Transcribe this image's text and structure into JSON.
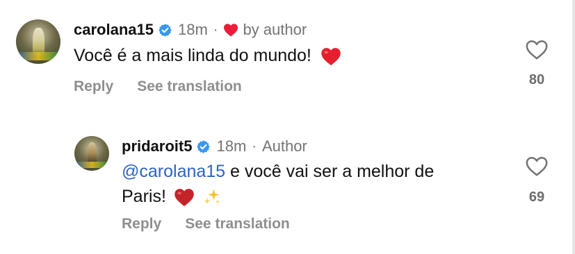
{
  "comments": [
    {
      "username": "carolana15",
      "time": "18m",
      "author_like": "by author",
      "text": "Você é a mais linda do mundo!",
      "reply_label": "Reply",
      "translate_label": "See translation",
      "likes": "80"
    },
    {
      "username": "pridaroit5",
      "time": "18m",
      "author_badge": "Author",
      "mention": "@carolana15",
      "text_line1": " e você vai ser a melhor de",
      "text_line2": "Paris!",
      "reply_label": "Reply",
      "translate_label": "See translation",
      "likes": "69"
    }
  ],
  "colors": {
    "verified": "#3897f0",
    "heart": "#ed1c3b",
    "mention": "#2b63c6",
    "muted": "#8e8e8e"
  },
  "icons": [
    "verified-badge-icon",
    "heart-icon",
    "like-heart-outline-icon",
    "sparkles-icon"
  ]
}
